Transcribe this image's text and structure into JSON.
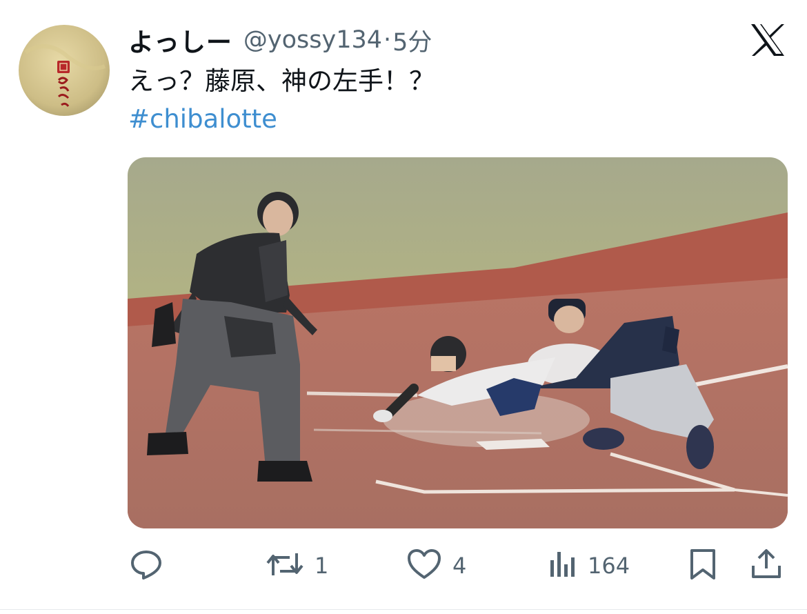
{
  "tweet": {
    "display_name": "よっしー",
    "handle": "@yossy134",
    "separator": "·",
    "time": "5分",
    "text": "えっ？藤原、神の左手！？",
    "hashtag": "#chibalotte",
    "avatar_icon": "avatar-logo",
    "platform_logo": "x-logo-icon"
  },
  "actions": {
    "reply": {
      "icon": "reply-bubble-icon",
      "count": ""
    },
    "retweet": {
      "icon": "retweet-icon",
      "count": "1"
    },
    "like": {
      "icon": "heart-icon",
      "count": "4"
    },
    "views": {
      "icon": "bar-chart-icon",
      "count": "164"
    },
    "bookmark": {
      "icon": "bookmark-icon"
    },
    "share": {
      "icon": "share-upload-icon"
    }
  },
  "colors": {
    "text": "#0f1419",
    "secondary": "#536471",
    "link": "#3e8ed0",
    "background": "#ffffff"
  }
}
